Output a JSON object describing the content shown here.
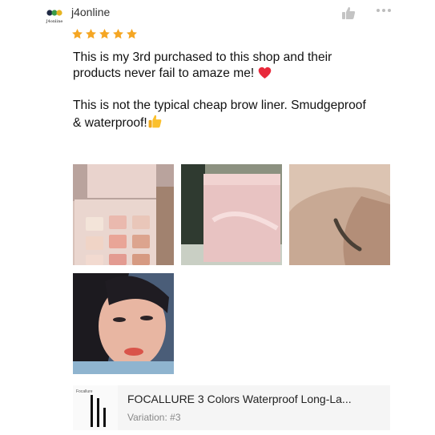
{
  "review": {
    "username": "j4online",
    "rating": 5,
    "paragraphs": [
      "This is my 3rd purchased to this shop and their products never fail to amaze me!",
      "This is not the typical cheap brow liner. Smudgeproof & waterproof!"
    ]
  },
  "icons": {
    "like": "thumbs-up-icon",
    "more": "more-options-icon",
    "star": "star-icon",
    "heart": "red-heart-emoji",
    "thumbs_emoji": "thumbs-up-emoji"
  },
  "colors": {
    "star": "#f5a623",
    "icon_gray": "#c4c4c4",
    "heart": "#e8293b",
    "product_bg": "#f5f5f5"
  },
  "photos": [
    {
      "subject": "eyeshadow palette"
    },
    {
      "subject": "pink product box"
    },
    {
      "subject": "brow liner swatch on wrist"
    },
    {
      "subject": "selfie"
    }
  ],
  "product": {
    "name": "FOCALLURE 3 Colors Waterproof Long-La...",
    "variation": "Variation: #3",
    "thumb_brand": "Focallure"
  }
}
